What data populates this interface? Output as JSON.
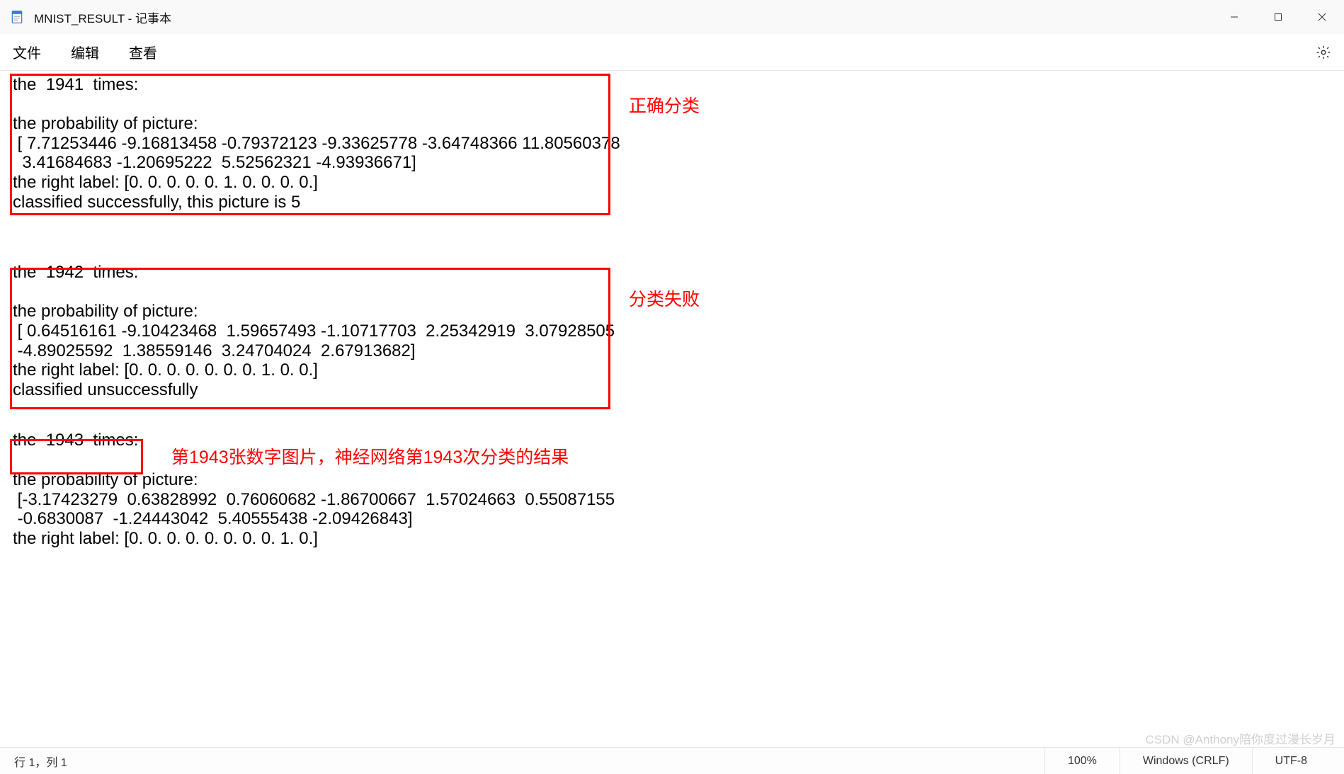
{
  "window": {
    "title": "MNIST_RESULT - 记事本"
  },
  "menu": {
    "file": "文件",
    "edit": "编辑",
    "view": "查看"
  },
  "content": {
    "block1": "the  1941  times:\n\nthe probability of picture:\n [ 7.71253446 -9.16813458 -0.79372123 -9.33625778 -3.64748366 11.80560378\n  3.41684683 -1.20695222  5.52562321 -4.93936671]\nthe right label: [0. 0. 0. 0. 0. 1. 0. 0. 0. 0.]\nclassified successfully, this picture is 5",
    "block2": "the  1942  times:\n\nthe probability of picture:\n [ 0.64516161 -9.10423468  1.59657493 -1.10717703  2.25342919  3.07928505\n -4.89025592  1.38559146  3.24704024  2.67913682]\nthe right label: [0. 0. 0. 0. 0. 0. 0. 1. 0. 0.]\nclassified unsuccessfully",
    "block3_header": "the  1943  times:",
    "block3_body": "the probability of picture:\n [-3.17423279  0.63828992  0.76060682 -1.86700667  1.57024663  0.55087155\n -0.6830087  -1.24443042  5.40555438 -2.09426843]\nthe right label: [0. 0. 0. 0. 0. 0. 0. 0. 1. 0.]"
  },
  "annotations": {
    "correct": "正确分类",
    "failed": "分类失败",
    "note1943": "第1943张数字图片，神经网络第1943次分类的结果"
  },
  "statusbar": {
    "position": "行 1，列 1",
    "zoom": "100%",
    "line_ending": "Windows (CRLF)",
    "encoding": "UTF-8"
  },
  "watermark": "CSDN @Anthony陪你度过漫长岁月"
}
